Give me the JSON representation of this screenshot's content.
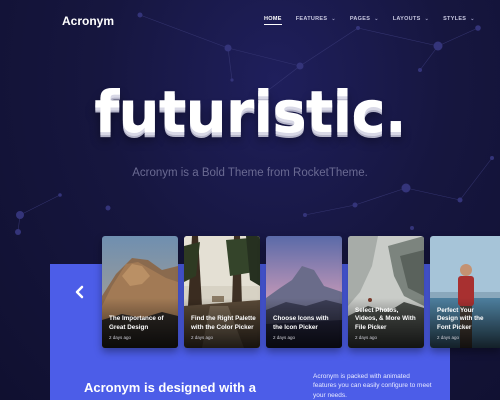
{
  "brand": {
    "logo": "Acronym"
  },
  "nav": {
    "items": [
      {
        "label": "Home",
        "has_dropdown": false,
        "active": true
      },
      {
        "label": "Features",
        "has_dropdown": true,
        "active": false
      },
      {
        "label": "Pages",
        "has_dropdown": true,
        "active": false
      },
      {
        "label": "Layouts",
        "has_dropdown": true,
        "active": false
      },
      {
        "label": "Styles",
        "has_dropdown": true,
        "active": false
      }
    ],
    "dropdown_icon": "chevron-down-icon"
  },
  "hero": {
    "headline": "futuristic.",
    "tagline": "Acronym is a Bold Theme from RocketTheme."
  },
  "carousel": {
    "prev_icon": "chevron-left-icon",
    "cards": [
      {
        "title": "The Importance of Great Design",
        "date": "2 days ago",
        "image": "rocky-mountain-peak-photo"
      },
      {
        "title": "Find the Right Palette with the Color Picker",
        "date": "2 days ago",
        "image": "forest-road-photo"
      },
      {
        "title": "Choose Icons with the Icon Picker",
        "date": "2 days ago",
        "image": "half-dome-valley-photo"
      },
      {
        "title": "Select Photos, Videos, & More With File Picker",
        "date": "2 days ago",
        "image": "foggy-cliff-photo"
      },
      {
        "title": "Perfect Your Design with the Font Picker",
        "date": "2 days ago",
        "image": "man-by-lake-photo"
      }
    ]
  },
  "intro": {
    "heading": "Acronym is designed with a",
    "text": "Acronym is packed with animated features you can easily configure to meet your needs."
  },
  "colors": {
    "background": "#15153a",
    "panel": "#4c5de8",
    "tagline": "#6a6a92"
  }
}
